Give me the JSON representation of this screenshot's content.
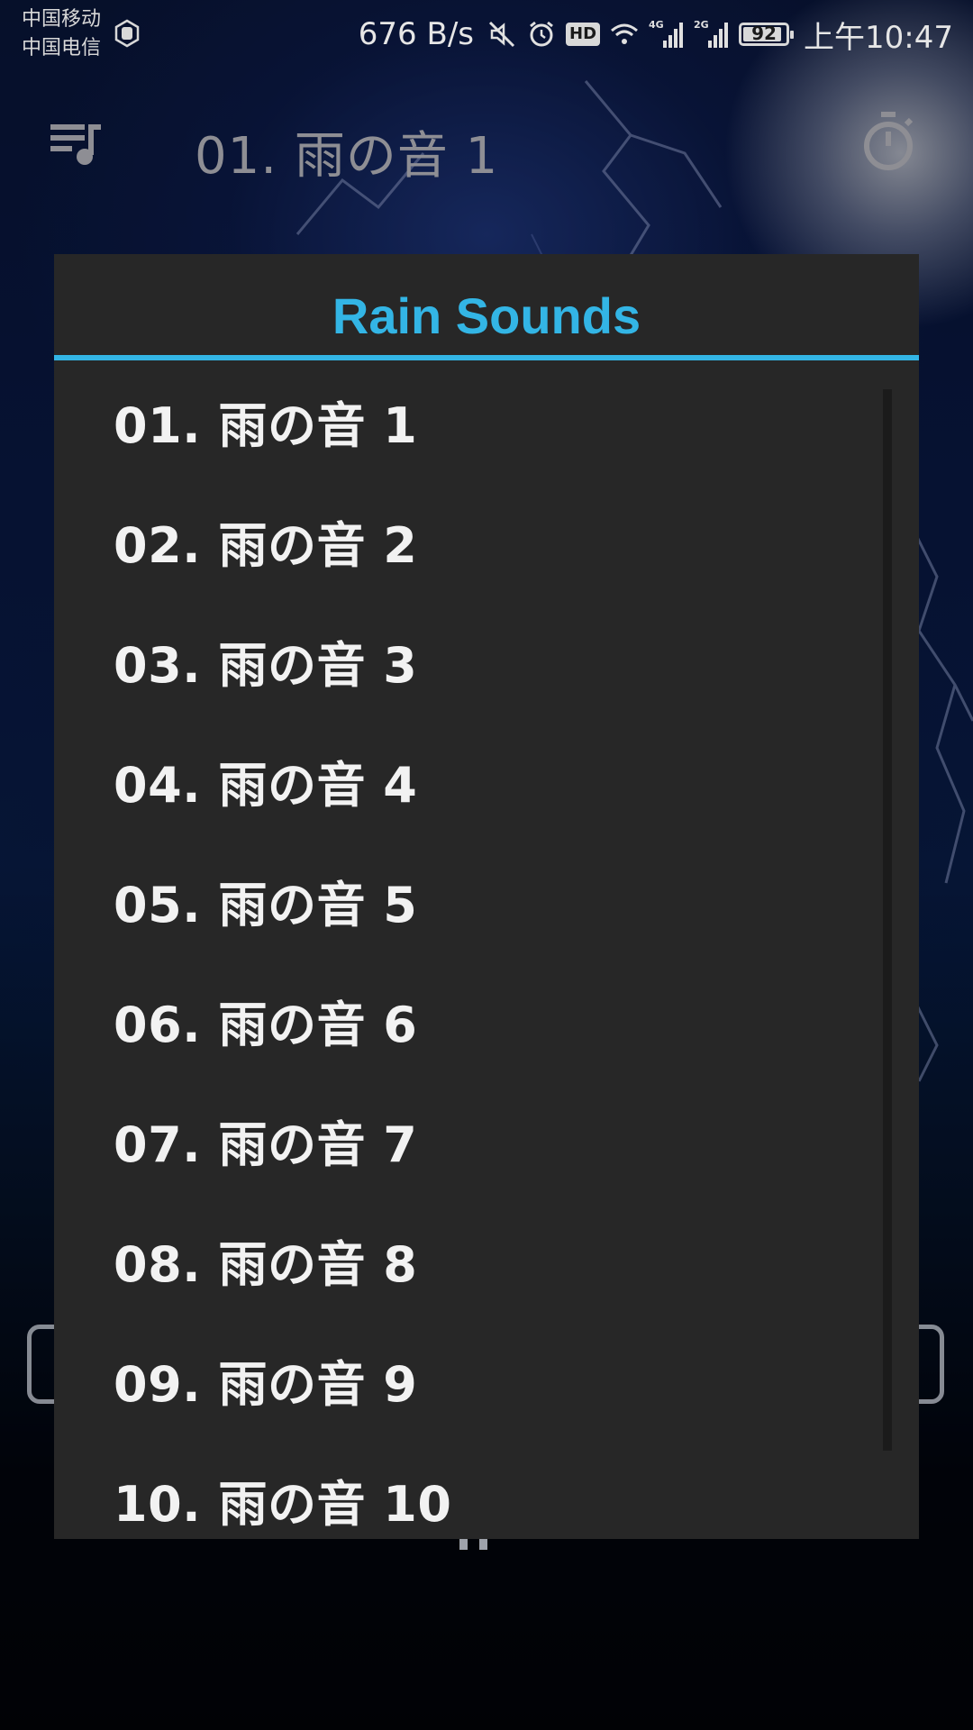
{
  "status_bar": {
    "carrier_1": "中国移动",
    "carrier_2": "中国电信",
    "net_speed": "676 B/s",
    "hd_label": "HD",
    "net_4g": "4G",
    "net_2g": "2G",
    "battery": "92",
    "battery_level": 0.92,
    "time": "上午10:47"
  },
  "toolbar": {
    "now_playing": "01. 雨の音 1"
  },
  "dialog": {
    "title": "Rain Sounds",
    "accent_color": "#33b5e5",
    "items": [
      {
        "label": "01. 雨の音 1"
      },
      {
        "label": "02. 雨の音 2"
      },
      {
        "label": "03. 雨の音 3"
      },
      {
        "label": "04. 雨の音 4"
      },
      {
        "label": "05. 雨の音 5"
      },
      {
        "label": "06. 雨の音 6"
      },
      {
        "label": "07. 雨の音 7"
      },
      {
        "label": "08. 雨の音 8"
      },
      {
        "label": "09. 雨の音 9"
      },
      {
        "label": "10. 雨の音 10"
      }
    ]
  },
  "icons": {
    "playlist": "playlist-music-icon",
    "timer": "timer-icon",
    "mute": "mute-icon",
    "alarm": "alarm-icon",
    "wifi": "wifi-icon",
    "signal": "signal-icon"
  }
}
